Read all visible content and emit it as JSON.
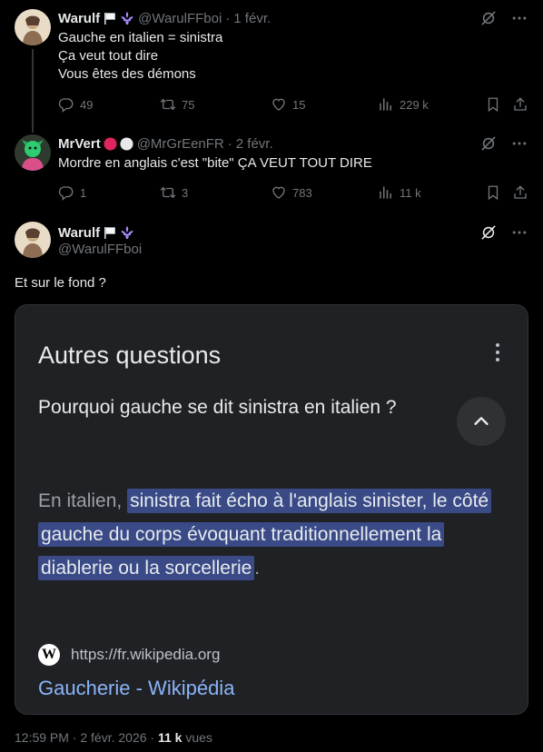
{
  "tweets": [
    {
      "name": "Warulf",
      "handle": "@WarulFFboi",
      "time": "1 févr.",
      "text": "Gauche en italien = sinistra\nÇa veut tout dire\nVous êtes des démons",
      "replies": "49",
      "retweets": "75",
      "likes": "15",
      "views": "229 k"
    },
    {
      "name": "MrVert",
      "handle": "@MrGrEenFR",
      "time": "2 févr.",
      "text": "Mordre en anglais c'est \"bite\" ÇA VEUT TOUT DIRE",
      "replies": "1",
      "retweets": "3",
      "likes": "783",
      "views": "11 k"
    }
  ],
  "main": {
    "name": "Warulf",
    "handle": "@WarulFFboi",
    "text": "Et sur le fond ?",
    "card": {
      "title": "Autres questions",
      "question": "Pourquoi gauche se dit sinistra en italien ?",
      "answer_plain": "En italien, ",
      "answer_highlight": "sinistra fait écho à l'anglais sinister, le côté gauche du corps évoquant traditionnellement la diablerie ou la sorcellerie",
      "answer_end": ".",
      "source_logo": "W",
      "source_url": "https://fr.wikipedia.org",
      "source_title": "Gaucherie - Wikipédia"
    },
    "footer": {
      "timestamp": "12:59 PM · 2 févr. 2026 · ",
      "views_count": "11 k",
      "views_label": " vues"
    }
  },
  "icons": {
    "more": "more-horizontal-icon",
    "grok": "grok-icon",
    "reply": "reply-icon",
    "retweet": "retweet-icon",
    "like": "heart-icon",
    "views": "views-chart-icon",
    "bookmark": "bookmark-icon",
    "share": "share-icon"
  },
  "colors": {
    "background": "#000000",
    "text": "#e7e9ea",
    "muted": "#71767b",
    "highlight": "#394a86",
    "link": "#8ab4f8"
  }
}
